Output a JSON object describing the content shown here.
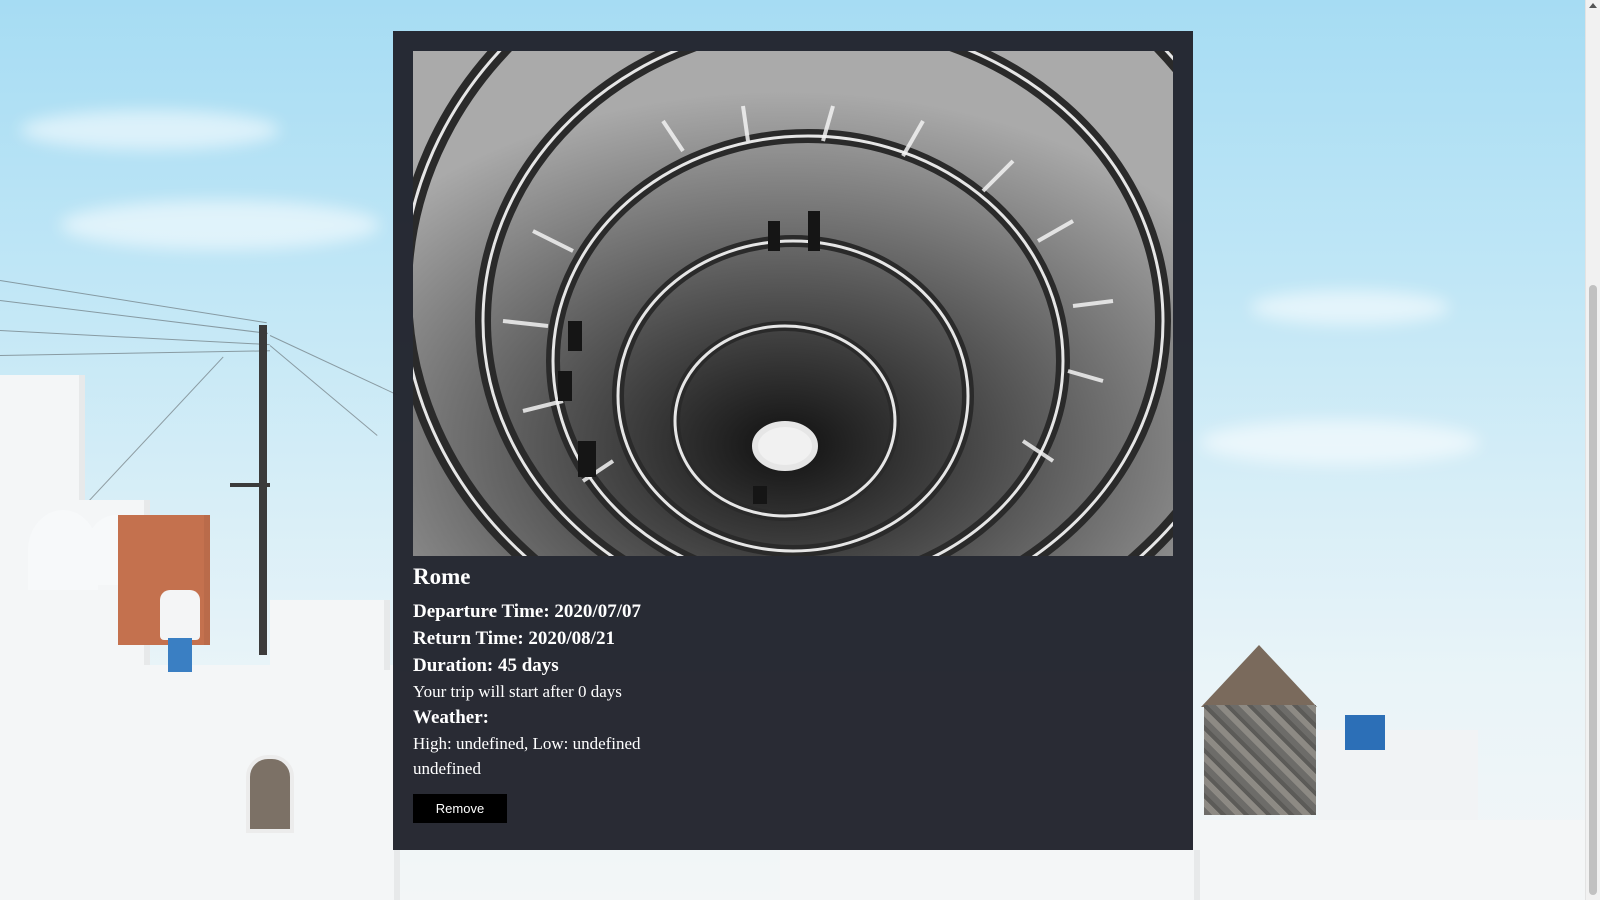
{
  "trip": {
    "city": "Rome",
    "departure": "Departure Time: 2020/07/07",
    "return": "Return Time: 2020/08/21",
    "duration": "Duration: 45 days",
    "countdown": "Your trip will start after 0 days",
    "weather_label": "Weather:",
    "weather_temps": "High: undefined, Low: undefined",
    "weather_description": "undefined",
    "remove_label": "Remove"
  },
  "colors": {
    "card_background": "#20222c",
    "button_background": "#000000",
    "text": "#ffffff"
  }
}
